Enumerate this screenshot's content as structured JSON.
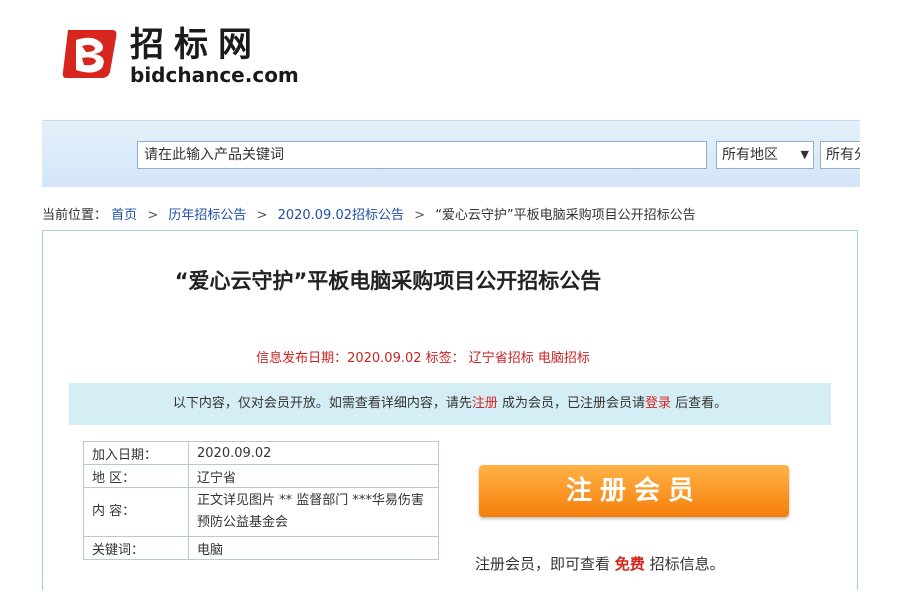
{
  "logo": {
    "cn": "招标网",
    "en": "bidchance.com"
  },
  "search": {
    "value": "请在此输入产品关键词",
    "region": "所有地区",
    "region_arrow": "▼",
    "category": "所有分"
  },
  "breadcrumb": {
    "prefix": "当前位置：",
    "items": [
      "首页",
      "历年招标公告",
      "2020.09.02招标公告"
    ],
    "sep": ">",
    "current": "“爱心云守护”平板电脑采购项目公开招标公告"
  },
  "article": {
    "title": "“爱心云守护”平板电脑采购项目公开招标公告",
    "meta": "信息发布日期：2020.09.02 标签：  辽宁省招标  电脑招标"
  },
  "notice": {
    "part1": "以下内容，仅对会员开放。如需查看详细内容，请先",
    "register_link": "注册",
    "part2": " 成为会员，已注册会员请",
    "login_link": "登录",
    "part3": " 后查看。"
  },
  "info": [
    {
      "key": "加入日期：",
      "value": "2020.09.02"
    },
    {
      "key": "地    区：",
      "value": "辽宁省"
    },
    {
      "key": "内    容：",
      "value": "正文详见图片 ** 监督部门 ***华易伤害预防公益基金会"
    },
    {
      "key": "关键词：",
      "value": "电脑"
    }
  ],
  "register": {
    "button": "注册会员",
    "note_pre": "注册会员，即可查看 ",
    "note_free": "免费",
    "note_post": " 招标信息。"
  },
  "colors": {
    "accent_red": "#d7261e",
    "link_blue": "#1f4fa8",
    "button_orange": "#f57e0a"
  }
}
